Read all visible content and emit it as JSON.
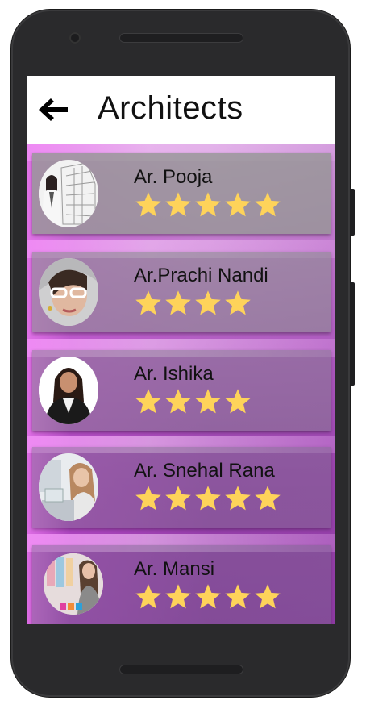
{
  "app": {
    "title": "Architects",
    "back_icon": "arrow-left-icon"
  },
  "colors": {
    "star": "#fed35a",
    "card_overlay": "rgba(150,150,150,0.55)",
    "accent": "#9a46ae"
  },
  "architects": [
    {
      "name": "Ar. Pooja",
      "rating": 5
    },
    {
      "name": "Ar.Prachi Nandi",
      "rating": 4
    },
    {
      "name": "Ar. Ishika",
      "rating": 4
    },
    {
      "name": "Ar. Snehal  Rana",
      "rating": 5
    },
    {
      "name": "Ar. Mansi",
      "rating": 5
    }
  ]
}
